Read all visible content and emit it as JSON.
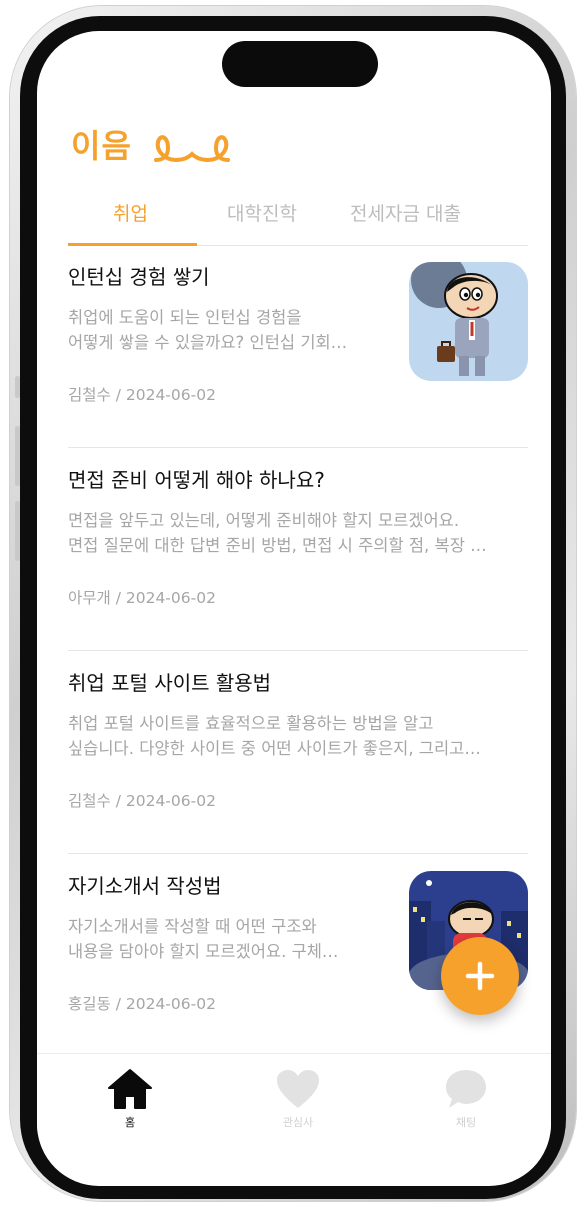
{
  "app": {
    "logo_text": "이음"
  },
  "tabs": [
    {
      "label": "취업",
      "active": true
    },
    {
      "label": "대학진학",
      "active": false
    },
    {
      "label": "전세자금 대출",
      "active": false
    }
  ],
  "posts": [
    {
      "title": "인턴십 경험 쌓기",
      "body_line1": "취업에 도움이 되는 인턴십 경험을",
      "body_line2": "어떻게 쌓을 수 있을까요? 인턴십 기회…",
      "meta": "김철수 / 2024-06-02",
      "thumbnail": "cartoon-businessman"
    },
    {
      "title": "면접 준비 어떻게 해야 하나요?",
      "body_line1": "면접을 앞두고 있는데, 어떻게 준비해야 할지 모르겠어요.",
      "body_line2": "면접 질문에 대한 답변 준비 방법, 면접 시 주의할 점, 복장 …",
      "meta": "아무개 / 2024-06-02"
    },
    {
      "title": "취업 포털 사이트 활용법",
      "body_line1": "취업 포털 사이트를 효율적으로 활용하는 방법을 알고",
      "body_line2": "싶습니다. 다양한 사이트 중 어떤 사이트가 좋은지, 그리고…",
      "meta": "김철수 / 2024-06-02"
    },
    {
      "title": "자기소개서 작성법",
      "body_line1": "자기소개서를 작성할 때 어떤 구조와",
      "body_line2": "내용을 담아야 할지 모르겠어요. 구체…",
      "meta": "홍길동 / 2024-06-02",
      "thumbnail": "cartoon-night-city"
    }
  ],
  "fab": {
    "icon": "plus-icon"
  },
  "bottom_nav": [
    {
      "label": "홈",
      "icon": "home-icon",
      "active": true
    },
    {
      "label": "관심사",
      "icon": "heart-icon",
      "active": false
    },
    {
      "label": "채팅",
      "icon": "chat-bubble-icon",
      "active": false
    }
  ],
  "colors": {
    "accent": "#f5a12c",
    "muted": "#a6a6a6",
    "inactive_nav": "#d6d6d6"
  }
}
